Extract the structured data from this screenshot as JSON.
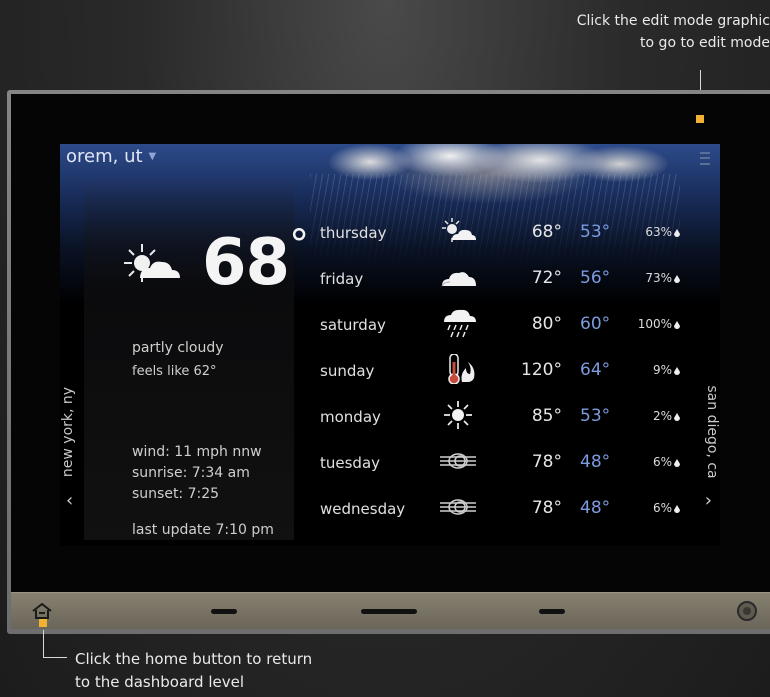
{
  "annotations": {
    "edit_line1": "Click the edit mode graphic",
    "edit_line2": "to go to edit mode",
    "home_line1": "Click the home button to return",
    "home_line2": "to the dashboard level"
  },
  "colors": {
    "accent": "#f1b234",
    "low_temp": "#7c9be0",
    "sky_top": "#2d4b8a"
  },
  "header": {
    "city": "orem, ut",
    "caret": "▼",
    "menu_icon": "menu-icon"
  },
  "current": {
    "temp": "68",
    "degree": "°",
    "condition": "partly cloudy",
    "feels_like": "feels like 62°",
    "wind": "wind: 11 mph nnw",
    "sunrise": "sunrise: 7:34 am",
    "sunset": "sunset: 7:25",
    "last_update": "last update 7:10 pm",
    "icon": "partly-cloudy-icon"
  },
  "nav": {
    "prev_city": "new york, ny",
    "next_city": "san diego, ca",
    "prev_arrow": "‹",
    "next_arrow": "›"
  },
  "forecast": [
    {
      "day": "thursday",
      "icon": "partly-cloudy-icon",
      "hi": "68°",
      "lo": "53°",
      "pop": "63%"
    },
    {
      "day": "friday",
      "icon": "cloudy-icon",
      "hi": "72°",
      "lo": "56°",
      "pop": "73%"
    },
    {
      "day": "saturday",
      "icon": "rain-icon",
      "hi": "80°",
      "lo": "60°",
      "pop": "100%"
    },
    {
      "day": "sunday",
      "icon": "hot-icon",
      "hi": "120°",
      "lo": "64°",
      "pop": "9%"
    },
    {
      "day": "monday",
      "icon": "sunny-icon",
      "hi": "85°",
      "lo": "53°",
      "pop": "2%"
    },
    {
      "day": "tuesday",
      "icon": "windy-icon",
      "hi": "78°",
      "lo": "48°",
      "pop": "6%"
    },
    {
      "day": "wednesday",
      "icon": "windy-icon",
      "hi": "78°",
      "lo": "48°",
      "pop": "6%"
    }
  ],
  "bottom_bar": {
    "home_icon": "home-icon",
    "power_icon": "power-icon"
  }
}
